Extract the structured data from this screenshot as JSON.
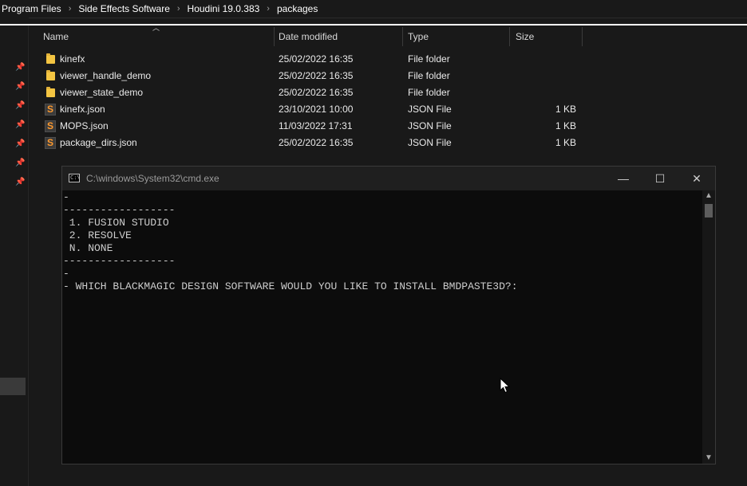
{
  "breadcrumb": [
    "Program Files",
    "Side Effects Software",
    "Houdini 19.0.383",
    "packages"
  ],
  "breadcrumb_separator": "›",
  "columns": {
    "name": "Name",
    "date": "Date modified",
    "type": "Type",
    "size": "Size"
  },
  "files": [
    {
      "name": "kinefx",
      "date": "25/02/2022 16:35",
      "type": "File folder",
      "size": "",
      "icon": "folder-icon"
    },
    {
      "name": "viewer_handle_demo",
      "date": "25/02/2022 16:35",
      "type": "File folder",
      "size": "",
      "icon": "folder-icon"
    },
    {
      "name": "viewer_state_demo",
      "date": "25/02/2022 16:35",
      "type": "File folder",
      "size": "",
      "icon": "folder-icon"
    },
    {
      "name": "kinefx.json",
      "date": "23/10/2021 10:00",
      "type": "JSON File",
      "size": "1 KB",
      "icon": "json-file-icon"
    },
    {
      "name": "MOPS.json",
      "date": "11/03/2022 17:31",
      "type": "JSON File",
      "size": "1 KB",
      "icon": "json-file-icon"
    },
    {
      "name": "package_dirs.json",
      "date": "25/02/2022 16:35",
      "type": "JSON File",
      "size": "1 KB",
      "icon": "json-file-icon"
    }
  ],
  "cmd": {
    "title": "C:\\windows\\System32\\cmd.exe",
    "lines": [
      "-",
      "------------------",
      " 1. FUSION STUDIO",
      " 2. RESOLVE",
      " N. NONE",
      "------------------",
      "-",
      "- WHICH BLACKMAGIC DESIGN SOFTWARE WOULD YOU LIKE TO INSTALL BMDPASTE3D?:"
    ],
    "buttons": {
      "minimize": "—",
      "maximize": "☐",
      "close": "✕"
    }
  },
  "colors": {
    "background": "#191919",
    "console_bg": "#0c0c0c",
    "console_text": "#cccccc",
    "folder": "#f4c542",
    "json_accent": "#ff9a2e"
  }
}
